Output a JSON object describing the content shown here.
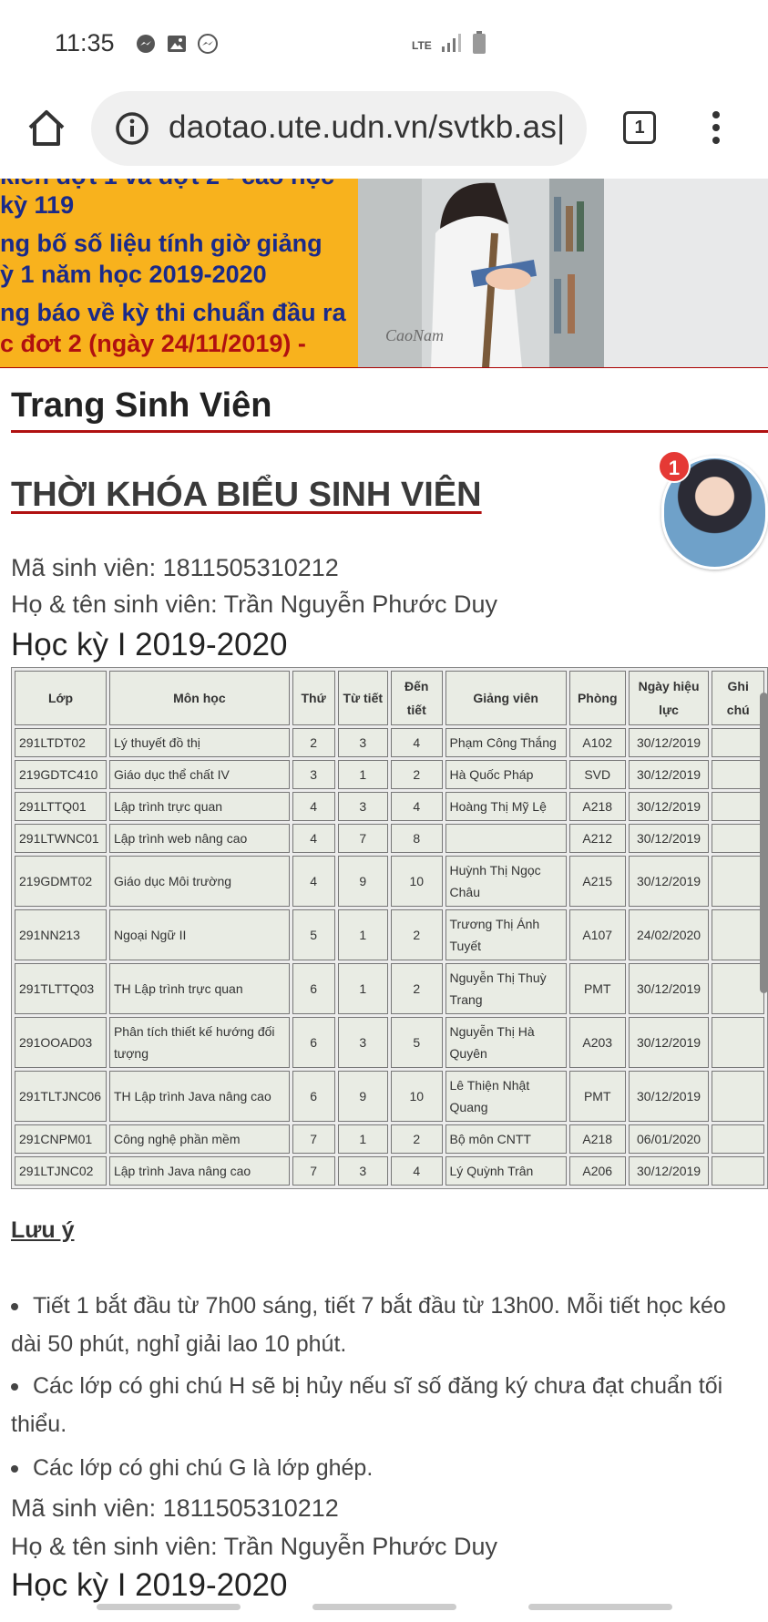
{
  "status_bar": {
    "time": "11:35",
    "icons": [
      "messenger-icon",
      "gallery-icon",
      "messenger-icon"
    ],
    "network": "LTE"
  },
  "browser": {
    "url": "daotao.ute.udn.vn/svtkb.as|",
    "tab_count": "1"
  },
  "banner": {
    "lines": [
      "kiến đợt 1 và đợt 2 - cao học",
      "kỳ 119",
      "ng bố số liệu tính giờ giảng",
      "ỳ 1 năm học 2019-2020",
      "ng báo về kỳ thi chuẩn đầu ra",
      "c đơt 2 (ngày 24/11/2019) -"
    ],
    "watermark": "CaoNam"
  },
  "page": {
    "heading": "Trang Sinh Viên",
    "schedule_heading": "THỜI KHÓA BIỂU SINH VIÊN",
    "avatar_badge": "1"
  },
  "student": {
    "id_line": "Mã sinh viên: 1811505310212",
    "name_line": "Họ & tên sinh viên: Trần Nguyễn Phước  Duy",
    "term": "Học kỳ I 2019-2020"
  },
  "table": {
    "headers": [
      "Lớp",
      "Môn học",
      "Thứ",
      "Từ tiết",
      "Đến tiết",
      "Giảng viên",
      "Phòng",
      "Ngày hiệu lực",
      "Ghi chú"
    ],
    "rows": [
      [
        "291LTDT02",
        "Lý thuyết đồ thị",
        "2",
        "3",
        "4",
        "Phạm Công Thắng",
        "A102",
        "30/12/2019",
        ""
      ],
      [
        "219GDTC410",
        "Giáo dục thể chất IV",
        "3",
        "1",
        "2",
        "Hà Quốc Pháp",
        "SVD",
        "30/12/2019",
        ""
      ],
      [
        "291LTTQ01",
        "Lập trình trực quan",
        "4",
        "3",
        "4",
        "Hoàng Thị Mỹ Lệ",
        "A218",
        "30/12/2019",
        ""
      ],
      [
        "291LTWNC01",
        "Lập trình web nâng cao",
        "4",
        "7",
        "8",
        "",
        "A212",
        "30/12/2019",
        ""
      ],
      [
        "219GDMT02",
        "Giáo dục Môi trường",
        "4",
        "9",
        "10",
        "Huỳnh Thị Ngọc Châu",
        "A215",
        "30/12/2019",
        ""
      ],
      [
        "291NN213",
        "Ngoại Ngữ II",
        "5",
        "1",
        "2",
        "Trương Thị Ánh Tuyết",
        "A107",
        "24/02/2020",
        ""
      ],
      [
        "291TLTTQ03",
        "TH Lập trình trực quan",
        "6",
        "1",
        "2",
        "Nguyễn Thị Thuỳ Trang",
        "PMT",
        "30/12/2019",
        ""
      ],
      [
        "291OOAD03",
        "Phân tích thiết kế hướng đối tượng",
        "6",
        "3",
        "5",
        "Nguyễn Thị Hà Quyên",
        "A203",
        "30/12/2019",
        ""
      ],
      [
        "291TLTJNC06",
        "TH Lập trình Java nâng cao",
        "6",
        "9",
        "10",
        "Lê Thiện Nhật Quang",
        "PMT",
        "30/12/2019",
        ""
      ],
      [
        "291CNPM01",
        "Công nghệ phần mềm",
        "7",
        "1",
        "2",
        "Bộ môn CNTT",
        "A218",
        "06/01/2020",
        ""
      ],
      [
        "291LTJNC02",
        "Lập trình Java nâng cao",
        "7",
        "3",
        "4",
        "Lý Quỳnh Trân",
        "A206",
        "30/12/2019",
        ""
      ]
    ]
  },
  "notes": {
    "title": "Lưu ý",
    "items": [
      "Tiết 1 bắt đầu từ 7h00 sáng, tiết 7 bắt đầu từ 13h00. Mỗi tiết học kéo dài 50 phút, nghỉ giải lao 10 phút.",
      "Các lớp có ghi chú H sẽ bị hủy nếu sĩ số đăng ký chưa đạt chuẩn tối thiểu.",
      "Các lớp có ghi chú G là lớp ghép."
    ]
  },
  "student_repeat": {
    "id_line": "Mã sinh viên: 1811505310212",
    "name_line": "Họ & tên sinh viên: Trần Nguyễn Phước  Duy",
    "term": "Học kỳ I 2019-2020"
  },
  "colors": {
    "banner_bg": "#f8b21d",
    "banner_text": "#1a2a8a",
    "accent_red": "#b01010",
    "table_cell": "#e9ece4"
  }
}
